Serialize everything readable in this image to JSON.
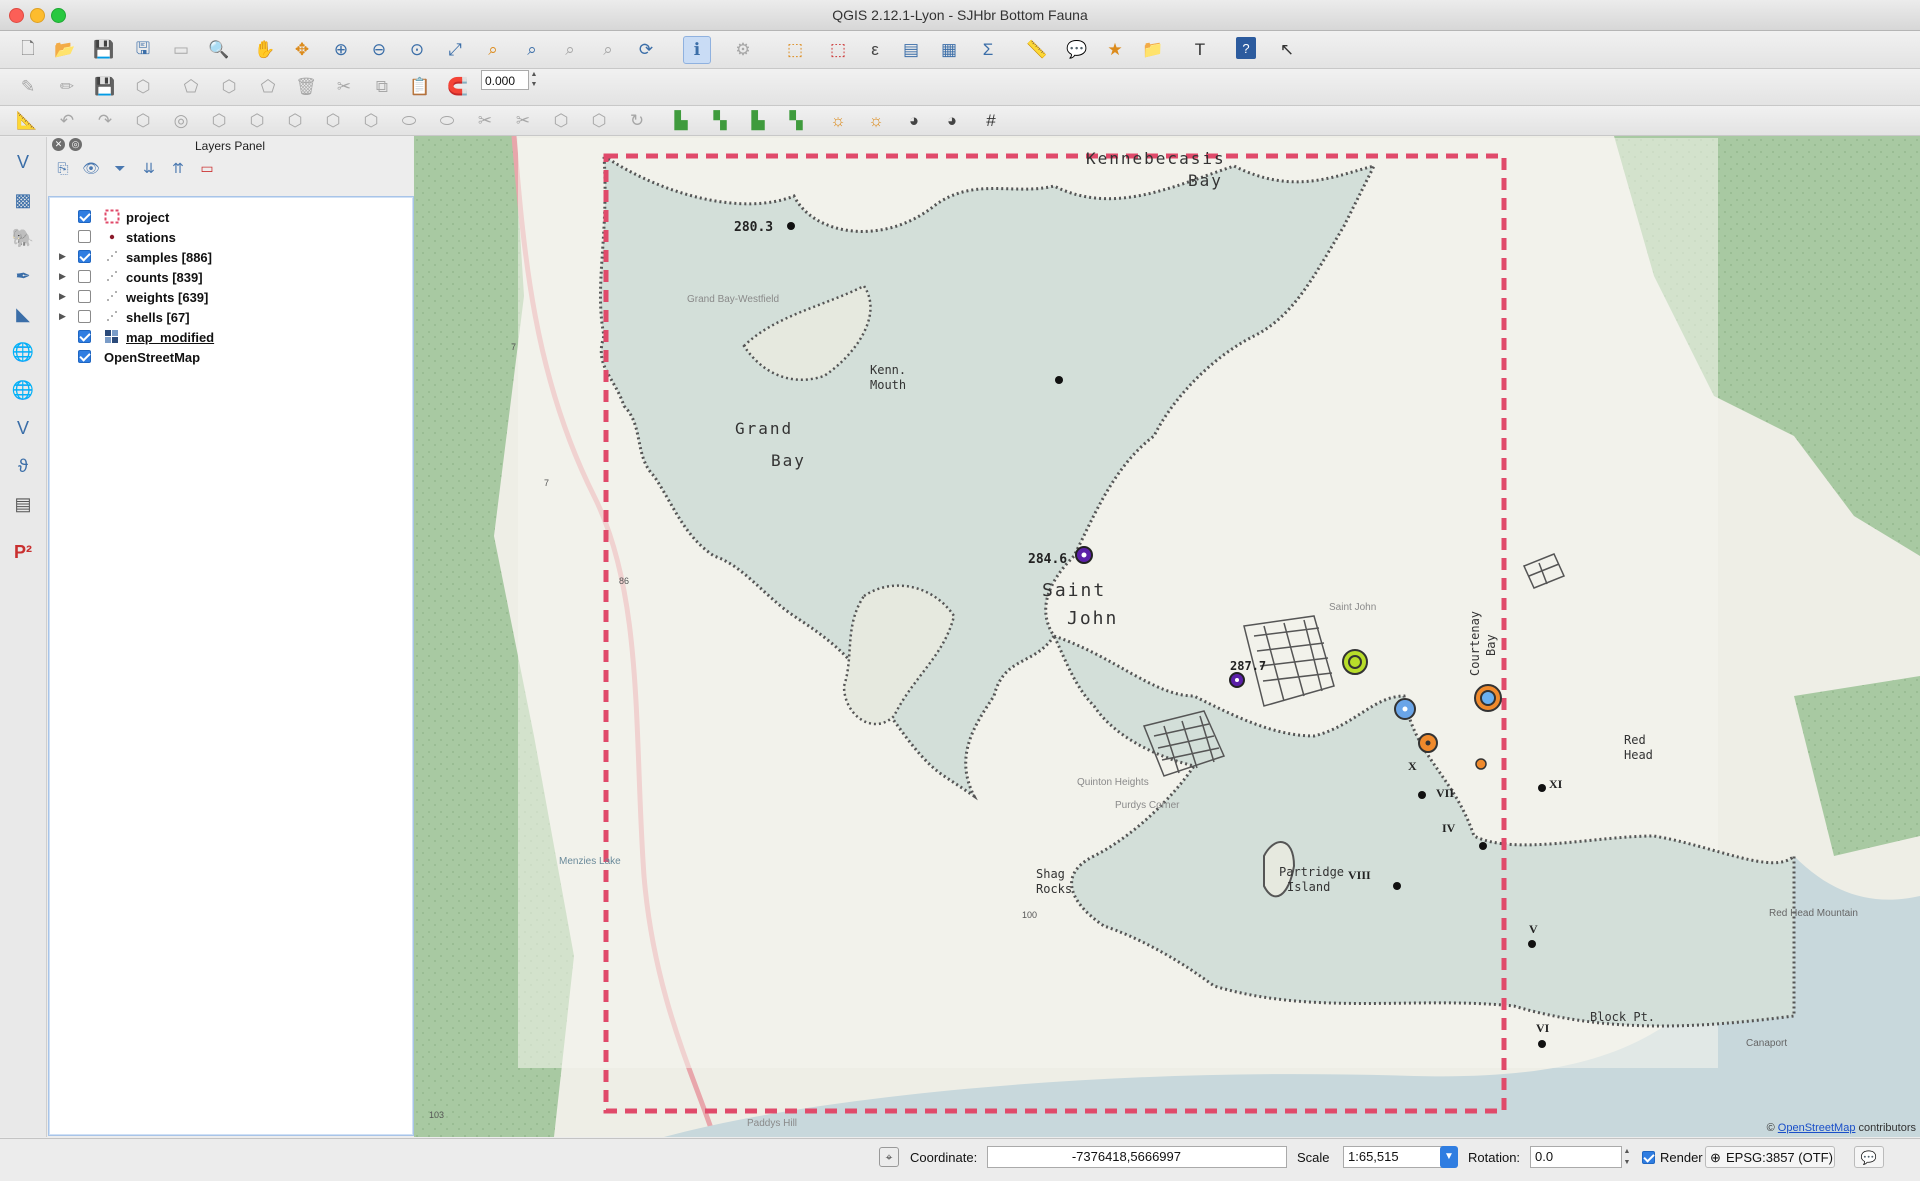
{
  "window": {
    "title": "QGIS 2.12.1-Lyon - SJHbr Bottom Fauna"
  },
  "toolbar_row1": [
    "new-project-icon",
    "open-project-icon",
    "save-project-icon",
    "save-as-icon",
    "new-print-composer-icon",
    "composer-manager-icon",
    "pan-icon",
    "pan-to-selection-icon",
    "zoom-in-icon",
    "zoom-out-icon",
    "zoom-native-icon",
    "zoom-full-icon",
    "zoom-to-selection-icon",
    "zoom-to-layer-icon",
    "zoom-last-icon",
    "zoom-next-icon",
    "refresh-icon",
    "identify-icon",
    "run-feature-action-icon",
    "select-icon",
    "deselect-icon",
    "select-by-expression-icon",
    "attribute-table-icon",
    "field-calculator-icon",
    "statistics-icon",
    "measure-icon",
    "map-tips-icon",
    "new-bookmark-icon",
    "show-bookmarks-icon",
    "text-annotation-icon",
    "help-icon",
    "whats-this-icon"
  ],
  "toolbar_row2": {
    "snap_tolerance": "0.000"
  },
  "layers_panel": {
    "title": "Layers Panel",
    "layers": [
      {
        "name": "project",
        "checked": true,
        "expandable": false,
        "symbol": "dashed-polygon"
      },
      {
        "name": "stations",
        "checked": false,
        "expandable": false,
        "symbol": "dot"
      },
      {
        "name": "samples [886]",
        "checked": true,
        "expandable": true,
        "symbol": "graduated"
      },
      {
        "name": "counts [839]",
        "checked": false,
        "expandable": true,
        "symbol": "graduated"
      },
      {
        "name": "weights [639]",
        "checked": false,
        "expandable": true,
        "symbol": "graduated"
      },
      {
        "name": "shells [67]",
        "checked": false,
        "expandable": true,
        "symbol": "graduated"
      },
      {
        "name": "map_modified",
        "checked": true,
        "expandable": false,
        "symbol": "raster"
      },
      {
        "name": "OpenStreetMap",
        "checked": true,
        "expandable": false,
        "symbol": "none"
      }
    ]
  },
  "map": {
    "labels": {
      "kennebecasis": "Kennebecasis",
      "bay": "Bay",
      "grand": "Grand",
      "grand_bay": "Bay",
      "kenn": "Kenn.",
      "mouth": "Mouth",
      "saint": "Saint",
      "john": "John",
      "courtenay": "Courtenay",
      "courtenay_bay": "Bay",
      "red": "Red",
      "head": "Head",
      "shag": "Shag",
      "rocks": "Rocks",
      "partridge": "Partridge",
      "island": "Island",
      "block_pt": "Block Pt.",
      "grand_bay_westfield": "Grand Bay-Westfield",
      "canaport": "Canaport",
      "red_head_mountain": "Red Head Mountain",
      "menzies_lake": "Menzies Lake",
      "quinton_heights": "Quinton Heights",
      "purdys_corner": "Purdys Corner",
      "paddys_hill": "Paddys Hill",
      "saint_john_small": "Saint John"
    },
    "depths": {
      "d1": "280.3",
      "d2": "284.6",
      "d3": "287.7"
    },
    "stations": {
      "s4": "IV",
      "s5": "V",
      "s6": "VI",
      "s7": "VII",
      "s8": "VIII",
      "s10": "X",
      "s11": "XI"
    },
    "highway_shields": {
      "h1": "7",
      "h2": "7",
      "h3": "86",
      "h4": "100",
      "h5": "103"
    },
    "attribution_prefix": "©",
    "attribution_link": "OpenStreetMap",
    "attribution_suffix": "contributors",
    "colors": {
      "project_border": "#e04a6a",
      "water": "#ccd9d5",
      "forest": "#a6c8a0"
    }
  },
  "statusbar": {
    "coordinate_label": "Coordinate:",
    "coordinate_value": "-7376418,5666997",
    "scale_label": "Scale",
    "scale_value": "1:65,515",
    "rotation_label": "Rotation:",
    "rotation_value": "0.0",
    "render_label": "Render",
    "render_checked": true,
    "crs": "EPSG:3857 (OTF)"
  }
}
